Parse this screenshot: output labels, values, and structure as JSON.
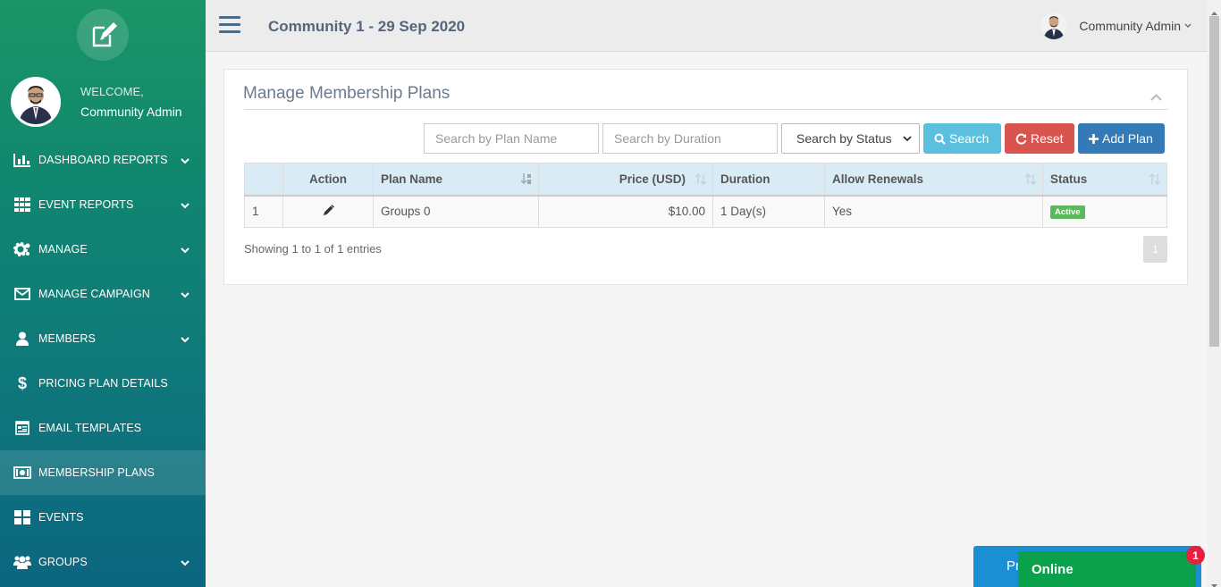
{
  "sidebar": {
    "welcome": "WELCOME,",
    "user_name": "Community Admin",
    "items": [
      {
        "label": "DASHBOARD REPORTS",
        "icon": "bar-chart-icon",
        "has_chevron": true
      },
      {
        "label": "EVENT REPORTS",
        "icon": "grid-icon",
        "has_chevron": true
      },
      {
        "label": "MANAGE",
        "icon": "gear-icon",
        "has_chevron": true
      },
      {
        "label": "MANAGE CAMPAIGN",
        "icon": "envelope-icon",
        "has_chevron": true
      },
      {
        "label": "MEMBERS",
        "icon": "user-icon",
        "has_chevron": true
      },
      {
        "label": "PRICING PLAN DETAILS",
        "icon": "dollar-icon",
        "has_chevron": false
      },
      {
        "label": "EMAIL TEMPLATES",
        "icon": "template-icon",
        "has_chevron": false
      },
      {
        "label": "MEMBERSHIP PLANS",
        "icon": "money-icon",
        "has_chevron": false,
        "active": true
      },
      {
        "label": "EVENTS",
        "icon": "tiles-icon",
        "has_chevron": false
      },
      {
        "label": "GROUPS",
        "icon": "users-icon",
        "has_chevron": true
      }
    ]
  },
  "header": {
    "title": "Community 1 - 29 Sep 2020",
    "user_name": "Community Admin"
  },
  "main": {
    "title": "Manage Membership Plans",
    "filters": {
      "plan_name_placeholder": "Search by Plan Name",
      "duration_placeholder": "Search by Duration",
      "status_selected": "Search by Status",
      "search_label": "Search",
      "reset_label": "Reset",
      "add_label": "Add Plan"
    },
    "table": {
      "columns": [
        "",
        "Action",
        "Plan Name",
        "Price (USD)",
        "Duration",
        "Allow Renewals",
        "Status"
      ],
      "rows": [
        {
          "index": "1",
          "plan_name": "Groups 0",
          "price": "$10.00",
          "duration": "1 Day(s)",
          "renewals": "Yes",
          "status": "Active"
        }
      ]
    },
    "info": "Showing 1 to 1 of 1 entries",
    "page": "1"
  },
  "widgets": {
    "promo_text": "Pr",
    "online_label": "Online",
    "notif_count": "1"
  },
  "colors": {
    "sidebar_top": "#1a9566",
    "sidebar_bottom": "#0b6680",
    "search_btn": "#5bc0de",
    "reset_btn": "#d9534f",
    "add_btn": "#337ab7",
    "active_badge": "#5cb85c",
    "online": "#0aa14a"
  }
}
